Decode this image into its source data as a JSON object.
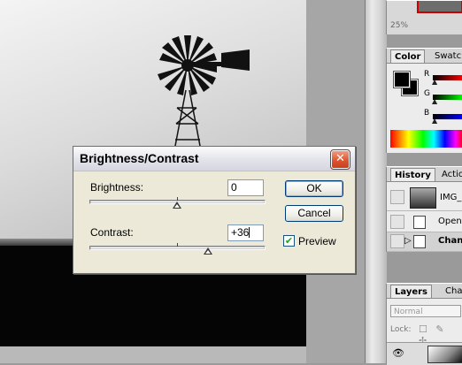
{
  "dialog": {
    "title": "Brightness/Contrast",
    "close_label": "✕",
    "brightness_label": "Brightness:",
    "brightness_value": "0",
    "contrast_label": "Contrast:",
    "contrast_value": "+36",
    "brightness_level": 0,
    "contrast_level": 36,
    "ok_label": "OK",
    "cancel_label": "Cancel",
    "preview_label": "Preview",
    "preview_checked": "✔"
  },
  "navigator": {
    "zoom": "25%"
  },
  "color_palette": {
    "tabs": [
      "Color",
      "Swatc"
    ],
    "channels": [
      "R",
      "G",
      "B"
    ],
    "colors": {
      "foreground": "#000000",
      "background": "#000000"
    }
  },
  "history_palette": {
    "tabs": [
      "History",
      "Action"
    ],
    "snapshot": "IMG_",
    "items": [
      "Open",
      "Chan"
    ]
  },
  "layers_palette": {
    "tabs": [
      "Layers",
      "Cha"
    ],
    "blend_mode": "Normal",
    "lock_label": "Lock:",
    "lock_icons": "☐ ✎ ✢"
  }
}
